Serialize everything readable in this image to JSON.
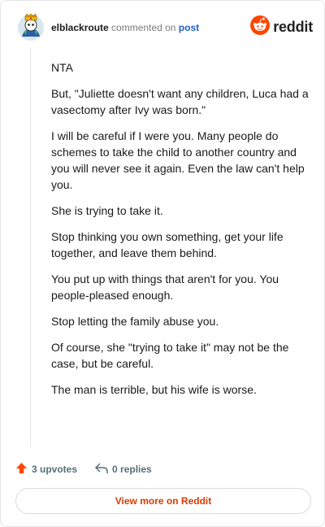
{
  "header": {
    "username": "elblackroute",
    "action": "commented on",
    "post_link": "post",
    "brand": "reddit"
  },
  "comment": {
    "paragraphs": [
      "NTA",
      "But, \"Juliette doesn't want any children, Luca had a vasectomy after Ivy was born.\"",
      "I will be careful if I were you. Many people do schemes to take the child to another country and you will never see it again. Even the law can't help you.",
      "She is trying to take it.",
      "Stop thinking you own something, get your life together, and leave them behind.",
      "You put up with things that aren't for you. You people-pleased enough.",
      "Stop letting the family abuse you.",
      "Of course, she \"trying to take it\" may not be the case, but be careful.",
      "The man is terrible, but his wife is worse."
    ]
  },
  "footer": {
    "upvotes": "3 upvotes",
    "replies": "0 replies",
    "view_more": "View more on Reddit"
  },
  "icons": {
    "upvote": "upvote-arrow-icon",
    "reply": "reply-arrow-icon",
    "brand_logo": "reddit-snoo-icon",
    "avatar": "user-avatar"
  },
  "colors": {
    "brand_orange": "#ff4500",
    "link_blue": "#1f5fbf",
    "cta_orange": "#d93a00",
    "muted": "#576f76"
  }
}
